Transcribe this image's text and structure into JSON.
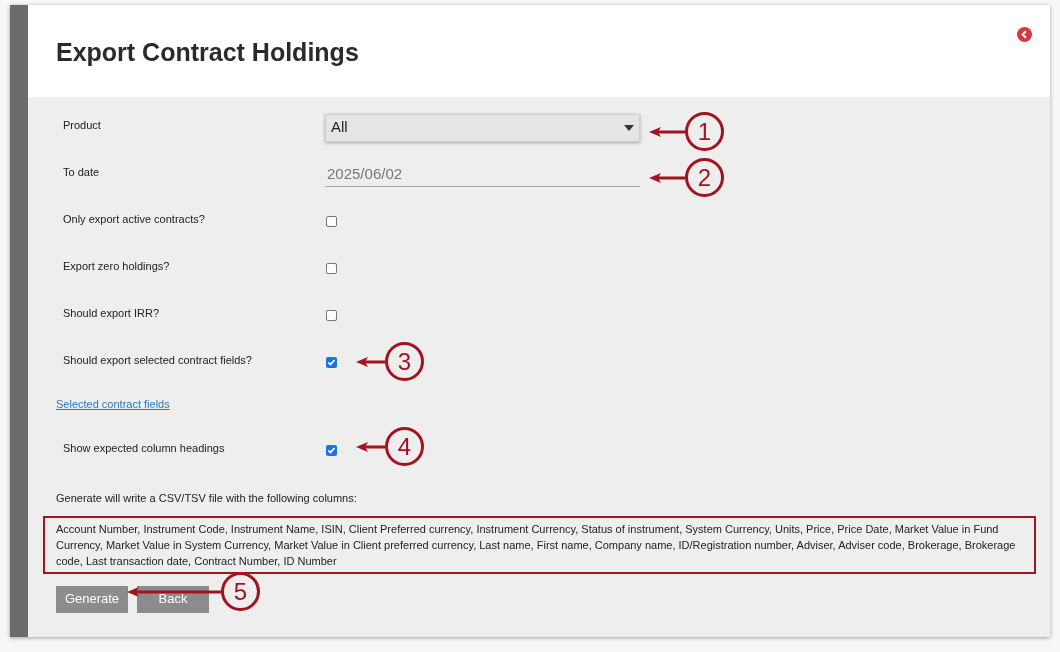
{
  "title": "Export Contract Holdings",
  "fields": [
    {
      "kind": "select",
      "label": "Product",
      "value": "All"
    },
    {
      "kind": "date",
      "label": "To date",
      "value": "2025/06/02"
    },
    {
      "kind": "checkbox",
      "label": "Only export active contracts?",
      "checked": false
    },
    {
      "kind": "checkbox",
      "label": "Export zero holdings?",
      "checked": false
    },
    {
      "kind": "checkbox",
      "label": "Should export IRR?",
      "checked": false
    },
    {
      "kind": "checkbox",
      "label": "Should export selected contract fields?",
      "checked": true
    },
    {
      "kind": "link",
      "label": "Selected contract fields"
    },
    {
      "kind": "checkbox",
      "label": "Show expected column headings",
      "checked": true
    }
  ],
  "note": "Generate will write a CSV/TSV file with the following columns:",
  "columns_text": "Account Number, Instrument Code, Instrument Name, ISIN, Client Preferred currency, Instrument Currency, Status of instrument, System Currency, Units, Price, Price Date, Market Value in Fund Currency, Market Value in System Currency, Market Value in Client preferred currency, Last name, First name, Company name, ID/Registration number, Adviser, Adviser code, Brokerage, Brokerage code, Last transaction date, Contract Number, ID Number",
  "buttons": [
    "Generate",
    "Back"
  ],
  "callouts": [
    {
      "number": "1"
    },
    {
      "number": "2"
    },
    {
      "number": "3"
    },
    {
      "number": "4"
    },
    {
      "number": "5"
    }
  ]
}
